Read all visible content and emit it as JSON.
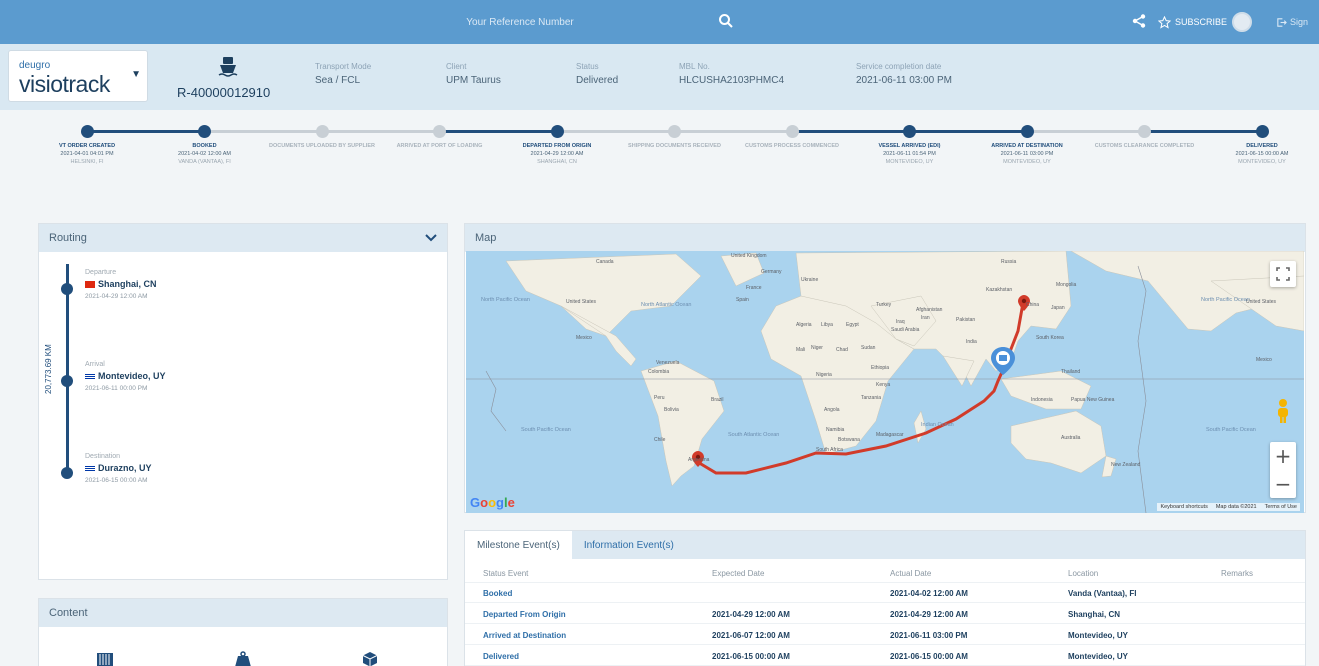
{
  "topbar": {
    "search_placeholder": "Your Reference Number",
    "subscribe_label": "SUBSCRIBE",
    "signout_label": "Sign"
  },
  "header": {
    "logo_small": "deugro",
    "logo_big": "visiotrack",
    "reference": "R-40000012910",
    "fields": [
      {
        "label": "Transport Mode",
        "value": "Sea / FCL"
      },
      {
        "label": "Client",
        "value": "UPM Taurus"
      },
      {
        "label": "Status",
        "value": "Delivered"
      },
      {
        "label": "MBL No.",
        "value": "HLCUSHA2103PHMC4"
      },
      {
        "label": "Service completion date",
        "value": "2021-06-11 03:00 PM"
      }
    ]
  },
  "milestones": [
    {
      "title": "VT ORDER CREATED",
      "state": "done",
      "date": "2021-04-01 04:01 PM",
      "location": "HELSINKI, FI"
    },
    {
      "title": "BOOKED",
      "state": "done",
      "date": "2021-04-02 12:00 AM",
      "location": "VANDA (VANTAA), FI"
    },
    {
      "title": "DOCUMENTS UPLOADED BY SUPPLIER",
      "state": "pending",
      "date": "",
      "location": ""
    },
    {
      "title": "ARRIVED AT PORT OF LOADING",
      "state": "pending",
      "date": "",
      "location": ""
    },
    {
      "title": "DEPARTED FROM ORIGIN",
      "state": "done",
      "date": "2021-04-29 12:00 AM",
      "location": "SHANGHAI, CN"
    },
    {
      "title": "SHIPPING DOCUMENTS RECEIVED",
      "state": "pending",
      "date": "",
      "location": ""
    },
    {
      "title": "CUSTOMS PROCESS COMMENCED",
      "state": "pending",
      "date": "",
      "location": ""
    },
    {
      "title": "VESSEL ARRIVED (EDI)",
      "state": "done",
      "date": "2021-06-11 01:54 PM",
      "location": "MONTEVIDEO, UY"
    },
    {
      "title": "ARRIVED AT DESTINATION",
      "state": "done",
      "date": "2021-06-11 03:00 PM",
      "location": "MONTEVIDEO, UY"
    },
    {
      "title": "CUSTOMS CLEARANCE COMPLETED",
      "state": "pending",
      "date": "",
      "location": ""
    },
    {
      "title": "DELIVERED",
      "state": "done",
      "date": "2021-06-15 00:00 AM",
      "location": "MONTEVIDEO, UY"
    }
  ],
  "routing": {
    "title": "Routing",
    "distance": "20,773.69 KM",
    "stops": [
      {
        "label": "Departure",
        "place": "Shanghai, CN",
        "date": "2021-04-29 12:00 AM",
        "flag": "cn"
      },
      {
        "label": "Arrival",
        "place": "Montevideo, UY",
        "date": "2021-06-11 00:00 PM",
        "flag": "uy"
      },
      {
        "label": "Destination",
        "place": "Durazno, UY",
        "date": "2021-06-15 00:00 AM",
        "flag": "uy"
      }
    ]
  },
  "content": {
    "title": "Content"
  },
  "map": {
    "title": "Map",
    "attribution": [
      "Keyboard shortcuts",
      "Map data ©2021",
      "Terms of Use"
    ],
    "labels": [
      {
        "text": "Canada"
      },
      {
        "text": "United States"
      },
      {
        "text": "North Pacific Ocean"
      },
      {
        "text": "North Atlantic Ocean"
      },
      {
        "text": "Mexico"
      },
      {
        "text": "Venezuela"
      },
      {
        "text": "Colombia"
      },
      {
        "text": "Peru"
      },
      {
        "text": "Bolivia"
      },
      {
        "text": "Brazil"
      },
      {
        "text": "Chile"
      },
      {
        "text": "Argentina"
      },
      {
        "text": "South Pacific Ocean"
      },
      {
        "text": "South Atlantic Ocean"
      },
      {
        "text": "Algeria"
      },
      {
        "text": "Libya"
      },
      {
        "text": "Egypt"
      },
      {
        "text": "Mali"
      },
      {
        "text": "Niger"
      },
      {
        "text": "Chad"
      },
      {
        "text": "Sudan"
      },
      {
        "text": "Nigeria"
      },
      {
        "text": "Ethiopia"
      },
      {
        "text": "Kenya"
      },
      {
        "text": "Tanzania"
      },
      {
        "text": "Angola"
      },
      {
        "text": "Namibia"
      },
      {
        "text": "Botswana"
      },
      {
        "text": "Madagascar"
      },
      {
        "text": "South Africa"
      },
      {
        "text": "Indian Ocean"
      },
      {
        "text": "Saudi Arabia"
      },
      {
        "text": "Iran"
      },
      {
        "text": "Turkey"
      },
      {
        "text": "Iraq"
      },
      {
        "text": "Afghanistan"
      },
      {
        "text": "Pakistan"
      },
      {
        "text": "India"
      },
      {
        "text": "Kazakhstan"
      },
      {
        "text": "Mongolia"
      },
      {
        "text": "China"
      },
      {
        "text": "Japan"
      },
      {
        "text": "South Korea"
      },
      {
        "text": "Thailand"
      },
      {
        "text": "Indonesia"
      },
      {
        "text": "Papua New Guinea"
      },
      {
        "text": "Australia"
      },
      {
        "text": "New Zealand"
      },
      {
        "text": "Russia"
      },
      {
        "text": "Germany"
      },
      {
        "text": "France"
      },
      {
        "text": "Spain"
      },
      {
        "text": "Ukraine"
      },
      {
        "text": "United Kingdom"
      },
      {
        "text": "North Pacific Ocean"
      },
      {
        "text": "South Pacific Ocean"
      },
      {
        "text": "Mexico"
      },
      {
        "text": "United States"
      }
    ]
  },
  "events": {
    "tabs": [
      "Milestone Event(s)",
      "Information Event(s)"
    ],
    "columns": [
      "Status Event",
      "Expected Date",
      "Actual Date",
      "Location",
      "Remarks"
    ],
    "rows": [
      {
        "event": "Booked",
        "expected": "",
        "actual": "2021-04-02 12:00 AM",
        "location": "Vanda (Vantaa), FI"
      },
      {
        "event": "Departed From Origin",
        "expected": "2021-04-29 12:00 AM",
        "actual": "2021-04-29 12:00 AM",
        "location": "Shanghai, CN"
      },
      {
        "event": "Arrived at Destination",
        "expected": "2021-06-07 12:00 AM",
        "actual": "2021-06-11 03:00 PM",
        "location": "Montevideo, UY"
      },
      {
        "event": "Delivered",
        "expected": "2021-06-15 00:00 AM",
        "actual": "2021-06-15 00:00 AM",
        "location": "Montevideo, UY"
      }
    ]
  },
  "colors": {
    "topbar": "#5b9bcf",
    "accent": "#214e7c",
    "route": "#d13b2a"
  }
}
